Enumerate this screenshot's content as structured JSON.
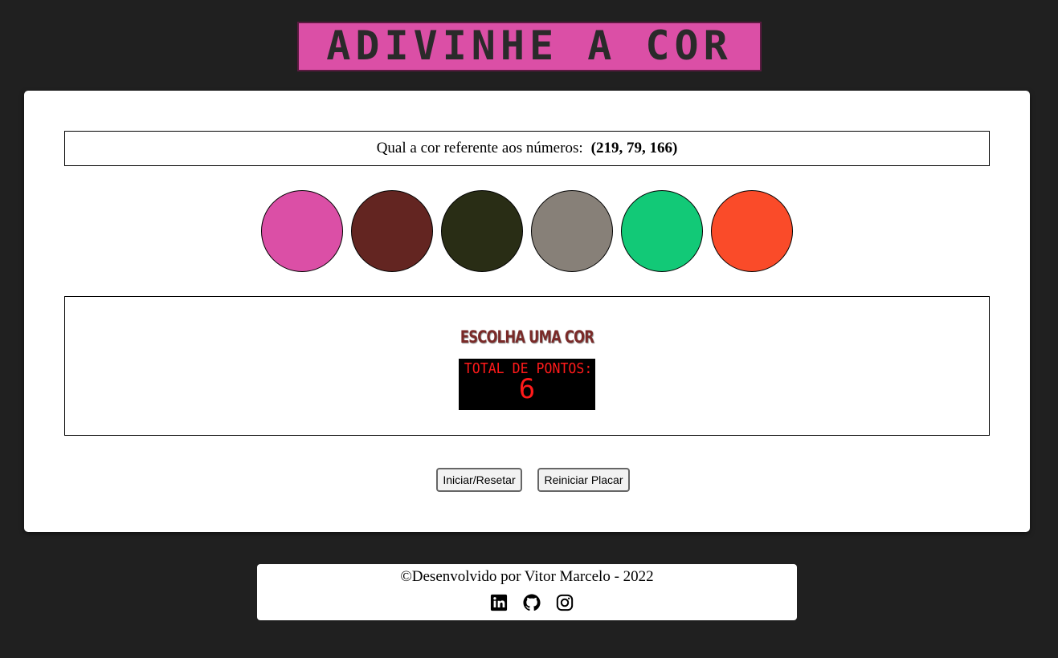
{
  "title": "ADIVINHE A COR",
  "question": {
    "label": "Qual a cor referente aos números:",
    "rgb_text": "(219, 79, 166)"
  },
  "colors": [
    "#db4fa6",
    "#632521",
    "#292d15",
    "#878078",
    "#12c977",
    "#fa4b29"
  ],
  "result": {
    "answer_text": "ESCOLHA UMA COR",
    "score_label": "TOTAL DE PONTOS:",
    "score_value": "6"
  },
  "buttons": {
    "start_label": "Iniciar/Resetar",
    "reset_label": "Reiniciar Placar"
  },
  "footer": {
    "credits": "©Desenvolvido por Vitor Marcelo - 2022",
    "icons": [
      "linkedin-icon",
      "github-icon",
      "instagram-icon"
    ]
  },
  "theme": {
    "background": "#202020",
    "title_color": "#db4fa6",
    "score_color": "#ff1a1a",
    "answer_color": "#7a2a28"
  }
}
